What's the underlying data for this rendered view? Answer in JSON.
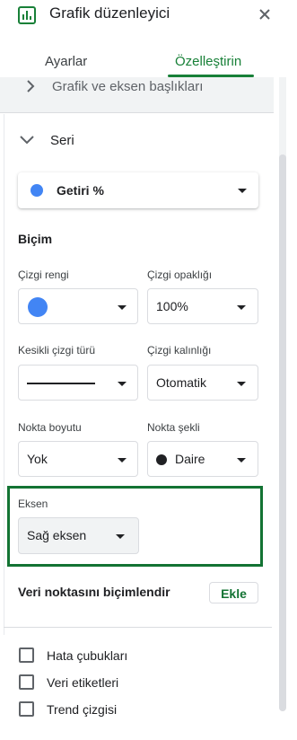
{
  "header": {
    "title": "Grafik düzenleyici",
    "icons": [
      "bar-chart-icon",
      "close-icon"
    ]
  },
  "tabs": [
    {
      "label": "Ayarlar",
      "active": false
    },
    {
      "label": "Özelleştirin",
      "active": true
    }
  ],
  "collapsed_section": {
    "label": "Grafik ve eksen başlıkları"
  },
  "series_section": {
    "title": "Seri",
    "selected_series": "Getiri %",
    "series_color": "#4285f4",
    "format": {
      "title": "Biçim",
      "line_color_label": "Çizgi rengi",
      "line_color_value": "#4285f4",
      "line_opacity_label": "Çizgi opaklığı",
      "line_opacity_value": "100%",
      "dash_type_label": "Kesikli çizgi türü",
      "line_thickness_label": "Çizgi kalınlığı",
      "line_thickness_value": "Otomatik",
      "point_size_label": "Nokta boyutu",
      "point_size_value": "Yok",
      "point_shape_label": "Nokta şekli",
      "point_shape_value": "Daire"
    },
    "axis": {
      "label": "Eksen",
      "value": "Sağ eksen",
      "highlight_color": "#137333"
    },
    "format_data_point": {
      "label": "Veri noktasını biçimlendir",
      "add_button": "Ekle"
    }
  },
  "checkboxes": [
    {
      "label": "Hata çubukları",
      "checked": false
    },
    {
      "label": "Veri etiketleri",
      "checked": false
    },
    {
      "label": "Trend çizgisi",
      "checked": false
    }
  ],
  "colors": {
    "accent_green": "#188038",
    "series_blue": "#4285f4"
  }
}
